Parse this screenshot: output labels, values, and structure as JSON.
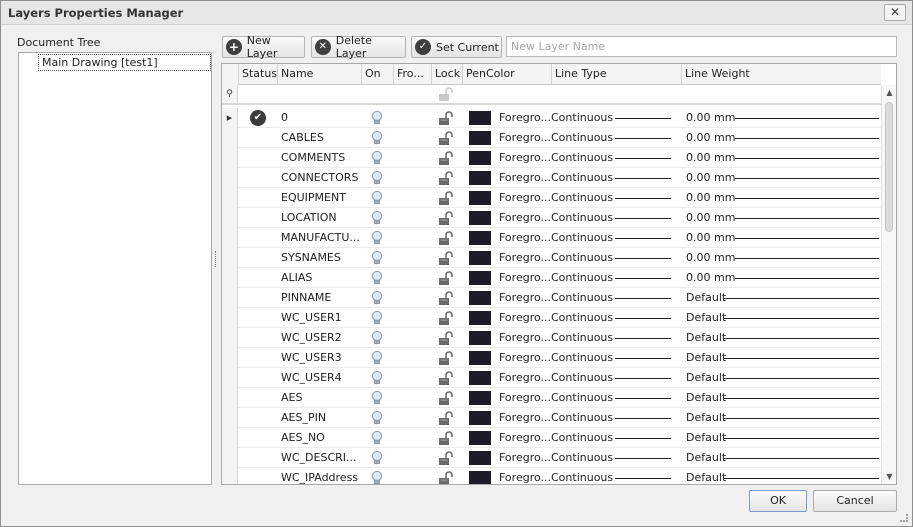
{
  "window": {
    "title": "Layers Properties Manager",
    "close_glyph": "✕"
  },
  "document_tree": {
    "label": "Document Tree",
    "node": "Main Drawing [test1]"
  },
  "toolbar": {
    "new_layer": "New Layer",
    "delete_layer": "Delete Layer",
    "set_current": "Set Current",
    "name_placeholder": "New Layer Name",
    "new_icon": "plus-icon",
    "delete_icon": "delete-x-icon",
    "set_current_icon": "checkmark-icon"
  },
  "grid": {
    "columns": [
      "Status",
      "Name",
      "On",
      "Fro...",
      "Lock",
      "PenColor",
      "Line Type",
      "Line Weight"
    ],
    "pen_color_hex": "#1c1c28",
    "rows": [
      {
        "name": "0",
        "current": true,
        "pen": "Foregro...",
        "line_type": "Continuous",
        "weight": "0.00 mm"
      },
      {
        "name": "CABLES",
        "current": false,
        "pen": "Foregro...",
        "line_type": "Continuous",
        "weight": "0.00 mm"
      },
      {
        "name": "COMMENTS",
        "current": false,
        "pen": "Foregro...",
        "line_type": "Continuous",
        "weight": "0.00 mm"
      },
      {
        "name": "CONNECTORS",
        "current": false,
        "pen": "Foregro...",
        "line_type": "Continuous",
        "weight": "0.00 mm"
      },
      {
        "name": "EQUIPMENT",
        "current": false,
        "pen": "Foregro...",
        "line_type": "Continuous",
        "weight": "0.00 mm"
      },
      {
        "name": "LOCATION",
        "current": false,
        "pen": "Foregro...",
        "line_type": "Continuous",
        "weight": "0.00 mm"
      },
      {
        "name": "MANUFACTU...",
        "current": false,
        "pen": "Foregro...",
        "line_type": "Continuous",
        "weight": "0.00 mm"
      },
      {
        "name": "SYSNAMES",
        "current": false,
        "pen": "Foregro...",
        "line_type": "Continuous",
        "weight": "0.00 mm"
      },
      {
        "name": "ALIAS",
        "current": false,
        "pen": "Foregro...",
        "line_type": "Continuous",
        "weight": "0.00 mm"
      },
      {
        "name": "PINNAME",
        "current": false,
        "pen": "Foregro...",
        "line_type": "Continuous",
        "weight": "Default"
      },
      {
        "name": "WC_USER1",
        "current": false,
        "pen": "Foregro...",
        "line_type": "Continuous",
        "weight": "Default"
      },
      {
        "name": "WC_USER2",
        "current": false,
        "pen": "Foregro...",
        "line_type": "Continuous",
        "weight": "Default"
      },
      {
        "name": "WC_USER3",
        "current": false,
        "pen": "Foregro...",
        "line_type": "Continuous",
        "weight": "Default"
      },
      {
        "name": "WC_USER4",
        "current": false,
        "pen": "Foregro...",
        "line_type": "Continuous",
        "weight": "Default"
      },
      {
        "name": "AES",
        "current": false,
        "pen": "Foregro...",
        "line_type": "Continuous",
        "weight": "Default"
      },
      {
        "name": "AES_PIN",
        "current": false,
        "pen": "Foregro...",
        "line_type": "Continuous",
        "weight": "Default"
      },
      {
        "name": "AES_NO",
        "current": false,
        "pen": "Foregro...",
        "line_type": "Continuous",
        "weight": "Default"
      },
      {
        "name": "WC_DESCRI...",
        "current": false,
        "pen": "Foregro...",
        "line_type": "Continuous",
        "weight": "Default"
      },
      {
        "name": "WC_IPAddress",
        "current": false,
        "pen": "Foregro...",
        "line_type": "Continuous",
        "weight": "Default"
      }
    ]
  },
  "footer": {
    "ok": "OK",
    "cancel": "Cancel"
  }
}
